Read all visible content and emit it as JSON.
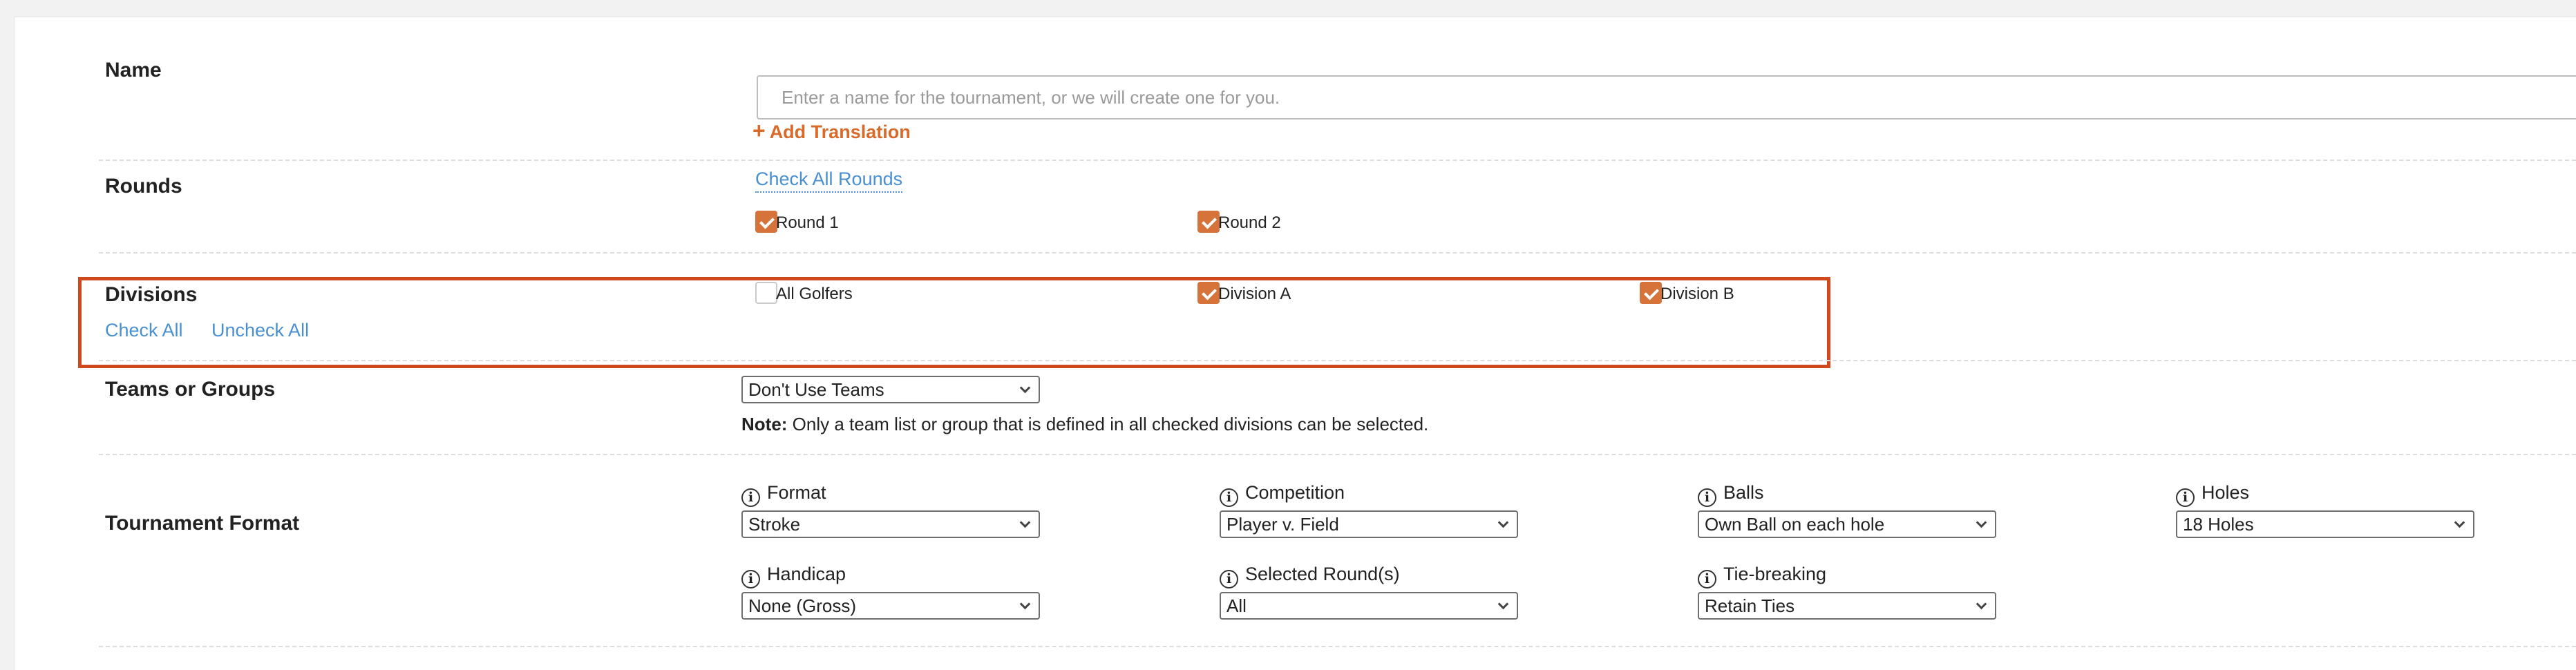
{
  "name_section": {
    "label": "Name",
    "placeholder": "Enter a name for the tournament, or we will create one for you.",
    "add_translation": "Add Translation"
  },
  "rounds": {
    "label": "Rounds",
    "check_all": "Check All Rounds",
    "items": [
      {
        "label": "Round 1",
        "checked": true
      },
      {
        "label": "Round 2",
        "checked": true
      }
    ]
  },
  "divisions": {
    "label": "Divisions",
    "check_all": "Check All",
    "uncheck_all": "Uncheck All",
    "items": [
      {
        "label": "All Golfers",
        "checked": false
      },
      {
        "label": "Division A",
        "checked": true
      },
      {
        "label": "Division B",
        "checked": true
      }
    ],
    "highlight_color": "#d0491e"
  },
  "teams": {
    "label": "Teams or Groups",
    "selected": "Don't Use Teams",
    "note_prefix": "Note:",
    "note_text": "Only a team list or group that is defined in all checked divisions can be selected."
  },
  "format": {
    "label": "Tournament Format",
    "fields": {
      "format": {
        "label": "Format",
        "value": "Stroke"
      },
      "competition": {
        "label": "Competition",
        "value": "Player v. Field"
      },
      "balls": {
        "label": "Balls",
        "value": "Own Ball on each hole"
      },
      "holes": {
        "label": "Holes",
        "value": "18 Holes"
      },
      "handicap": {
        "label": "Handicap",
        "value": "None (Gross)"
      },
      "selected_rounds": {
        "label": "Selected Round(s)",
        "value": "All"
      },
      "tie_breaking": {
        "label": "Tie-breaking",
        "value": "Retain Ties"
      }
    }
  },
  "colors": {
    "accent_orange": "#d5733a",
    "link_blue": "#4a8fd0"
  },
  "icons": {
    "info": "i",
    "plus": "+"
  }
}
